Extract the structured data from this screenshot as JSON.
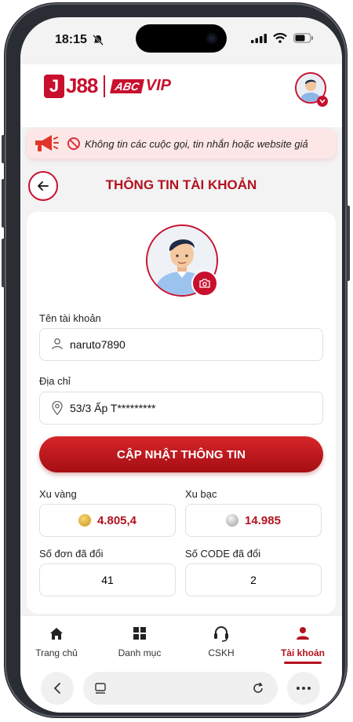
{
  "status": {
    "time": "18:15"
  },
  "header": {
    "logo_j88": "J88",
    "logo_abc": "ABC",
    "logo_vip": "VIP"
  },
  "notice": {
    "text": "Không tin các cuộc gọi, tin nhắn hoặc website giả"
  },
  "page": {
    "title": "THÔNG TIN TÀI KHOẢN"
  },
  "account": {
    "username_label": "Tên tài khoản",
    "username_value": "naruto7890",
    "address_label": "Địa chỉ",
    "address_value": "53/3 Ấp T*********",
    "update_button": "CẬP NHẬT THÔNG TIN"
  },
  "stats": {
    "gold_label": "Xu vàng",
    "gold_value": "4.805,4",
    "silver_label": "Xu bạc",
    "silver_value": "14.985",
    "orders_label": "Số đơn đã đổi",
    "orders_value": "41",
    "codes_label": "Số CODE đã đổi",
    "codes_value": "2"
  },
  "tabs": [
    {
      "label": "Trang chủ",
      "icon": "home-icon"
    },
    {
      "label": "Danh mục",
      "icon": "grid-icon"
    },
    {
      "label": "CSKH",
      "icon": "headset-icon"
    },
    {
      "label": "Tài khoản",
      "icon": "user-icon",
      "active": true
    }
  ],
  "colors": {
    "brand": "#c8102e",
    "title": "#b3121f"
  }
}
